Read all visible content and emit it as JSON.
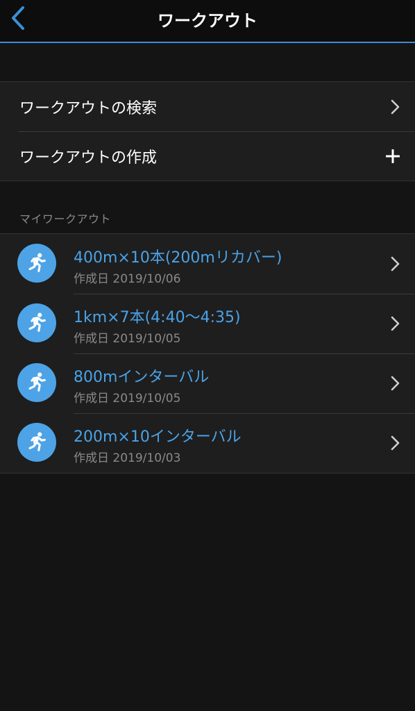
{
  "header": {
    "title": "ワークアウト",
    "back_icon": "chevron-left-icon",
    "accent_color": "#3b8fd6"
  },
  "menu": {
    "items": [
      {
        "label": "ワークアウトの検索",
        "trailing_icon": "chevron-right-icon"
      },
      {
        "label": "ワークアウトの作成",
        "trailing_icon": "plus-icon"
      }
    ]
  },
  "my_workouts": {
    "section_label": "マイワークアウト",
    "items": [
      {
        "title": "400m×10本(200mリカバー)",
        "created": "作成日 2019/10/06",
        "icon": "running-icon"
      },
      {
        "title": "1km×7本(4:40〜4:35)",
        "created": "作成日 2019/10/05",
        "icon": "running-icon"
      },
      {
        "title": "800mインターバル",
        "created": "作成日 2019/10/05",
        "icon": "running-icon"
      },
      {
        "title": "200m×10インターバル",
        "created": "作成日 2019/10/03",
        "icon": "running-icon"
      }
    ],
    "title_color": "#4aa3e8",
    "icon_bg_color": "#4da3e6"
  }
}
